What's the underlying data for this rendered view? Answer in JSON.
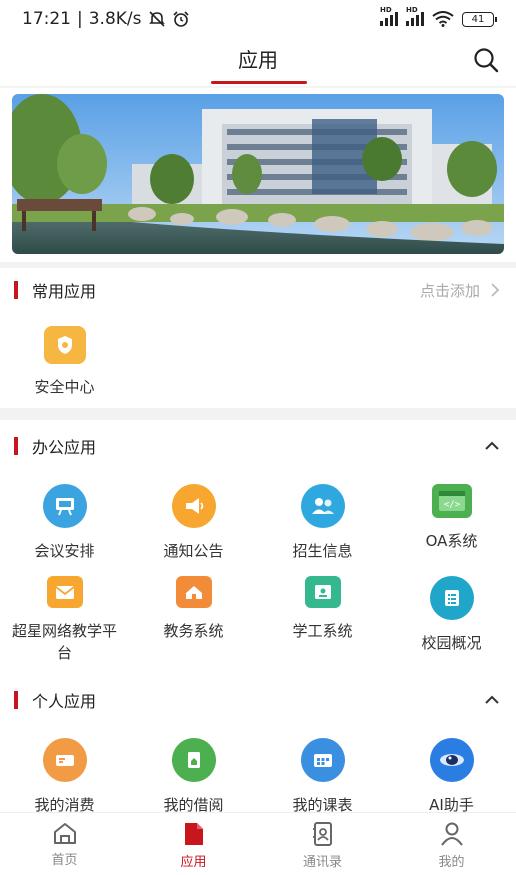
{
  "status_bar": {
    "time": "17:21",
    "speed": "3.8K/s",
    "battery": "41",
    "icons": [
      "mute-icon",
      "alarm-icon",
      "signal-icon",
      "signal-icon",
      "wifi-icon",
      "battery-icon"
    ]
  },
  "header": {
    "title": "应用",
    "search_icon": "search-icon"
  },
  "banner": {
    "image": "campus-photo"
  },
  "common_apps": {
    "title": "常用应用",
    "action": "点击添加",
    "items": [
      {
        "label": "安全中心",
        "icon": "shield-icon",
        "color": "#f5b642"
      }
    ]
  },
  "office_apps": {
    "title": "办公应用",
    "items": [
      {
        "label": "会议安排",
        "icon": "meeting-icon",
        "color": "#3aa3e0"
      },
      {
        "label": "通知公告",
        "icon": "notice-icon",
        "color": "#f7a630"
      },
      {
        "label": "招生信息",
        "icon": "people-icon",
        "color": "#2fa8df"
      },
      {
        "label": "OA系统",
        "icon": "code-window-icon",
        "color": "#4caf50"
      },
      {
        "label": "超星网络教学平台",
        "icon": "mail-icon",
        "color": "#f7a630"
      },
      {
        "label": "教务系统",
        "icon": "home-folder-icon",
        "color": "#f28c38"
      },
      {
        "label": "学工系统",
        "icon": "card-icon",
        "color": "#35b88f"
      },
      {
        "label": "校园概况",
        "icon": "list-icon",
        "color": "#1fa6c8"
      }
    ]
  },
  "personal_apps": {
    "title": "个人应用",
    "items": [
      {
        "label": "我的消费",
        "icon": "wallet-icon",
        "color": "#f29b45"
      },
      {
        "label": "我的借阅",
        "icon": "book-icon",
        "color": "#4caf50"
      },
      {
        "label": "我的课表",
        "icon": "schedule-icon",
        "color": "#3b8fe0"
      },
      {
        "label": "AI助手",
        "icon": "ai-eye-icon",
        "color": "#2a7de1"
      }
    ]
  },
  "bottom_nav": {
    "items": [
      {
        "label": "首页",
        "icon": "home-icon"
      },
      {
        "label": "应用",
        "icon": "app-doc-icon",
        "active": true
      },
      {
        "label": "通讯录",
        "icon": "contacts-icon"
      },
      {
        "label": "我的",
        "icon": "profile-icon"
      }
    ]
  },
  "colors": {
    "accent": "#c8161d"
  }
}
